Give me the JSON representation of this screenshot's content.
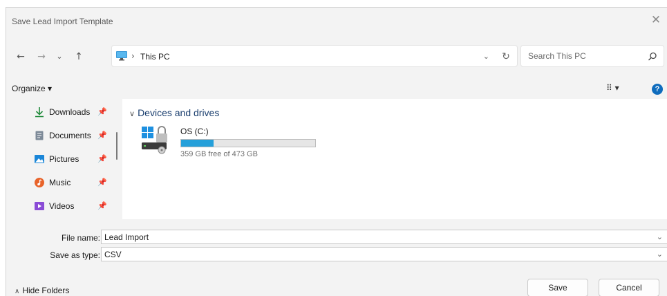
{
  "window": {
    "title": "Save Lead Import Template"
  },
  "nav": {
    "back_glyph": "←",
    "forward_glyph": "→",
    "recent_glyph": "⌄",
    "up_glyph": "↑",
    "location": "This PC",
    "location_icon": "monitor-icon",
    "search_placeholder": "Search This PC"
  },
  "toolbar": {
    "organize_label": "Organize ▾",
    "view_label": "⠿ ▾",
    "help_label": "?"
  },
  "sidebar": {
    "items": [
      {
        "label": "Downloads",
        "icon": "download-arrow-icon",
        "pinned": true
      },
      {
        "label": "Documents",
        "icon": "document-icon",
        "pinned": true
      },
      {
        "label": "Pictures",
        "icon": "picture-icon",
        "pinned": true
      },
      {
        "label": "Music",
        "icon": "music-icon",
        "pinned": true
      },
      {
        "label": "Videos",
        "icon": "video-icon",
        "pinned": true
      }
    ]
  },
  "main": {
    "group_title": "Devices and drives",
    "drives": [
      {
        "name": "OS (C:)",
        "free_text": "359 GB free of 473 GB",
        "used_fraction": 0.24
      }
    ]
  },
  "form": {
    "file_name_label": "File name:",
    "file_name_value": "Lead Import",
    "save_type_label": "Save as type:",
    "save_type_value": "CSV"
  },
  "footer": {
    "hide_folders_label": "Hide Folders",
    "save_label": "Save",
    "cancel_label": "Cancel"
  },
  "colors": {
    "accent": "#0f6cbd",
    "drive_bar": "#26a0da",
    "dialog_bg": "#f3f3f3"
  }
}
